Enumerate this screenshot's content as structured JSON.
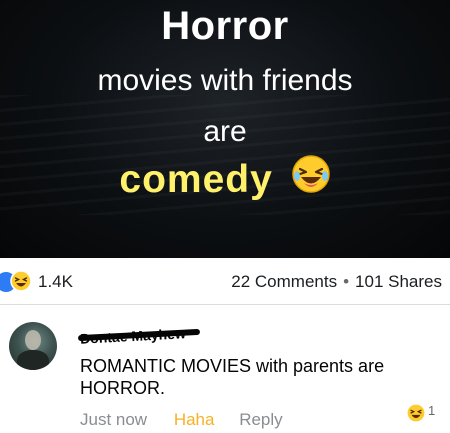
{
  "meme": {
    "line1": "Horror",
    "line2": "movies with friends",
    "line3": "are",
    "line4": "comedy",
    "emoji_icon": "laughing-face-icon",
    "accent_color": "#fff16a"
  },
  "reactions": {
    "icons": [
      "like-icon",
      "haha-icon"
    ],
    "count": "1.4K",
    "comments": "22 Comments",
    "separator": "•",
    "shares": "101 Shares"
  },
  "comment": {
    "author": "Dontae Mayhew",
    "text": "ROMANTIC MOVIES with parents are HORROR.",
    "time": "Just now",
    "haha_label": "Haha",
    "reply_label": "Reply",
    "reaction_icon": "haha-icon",
    "reaction_count": "1",
    "haha_color": "#f7b125"
  }
}
